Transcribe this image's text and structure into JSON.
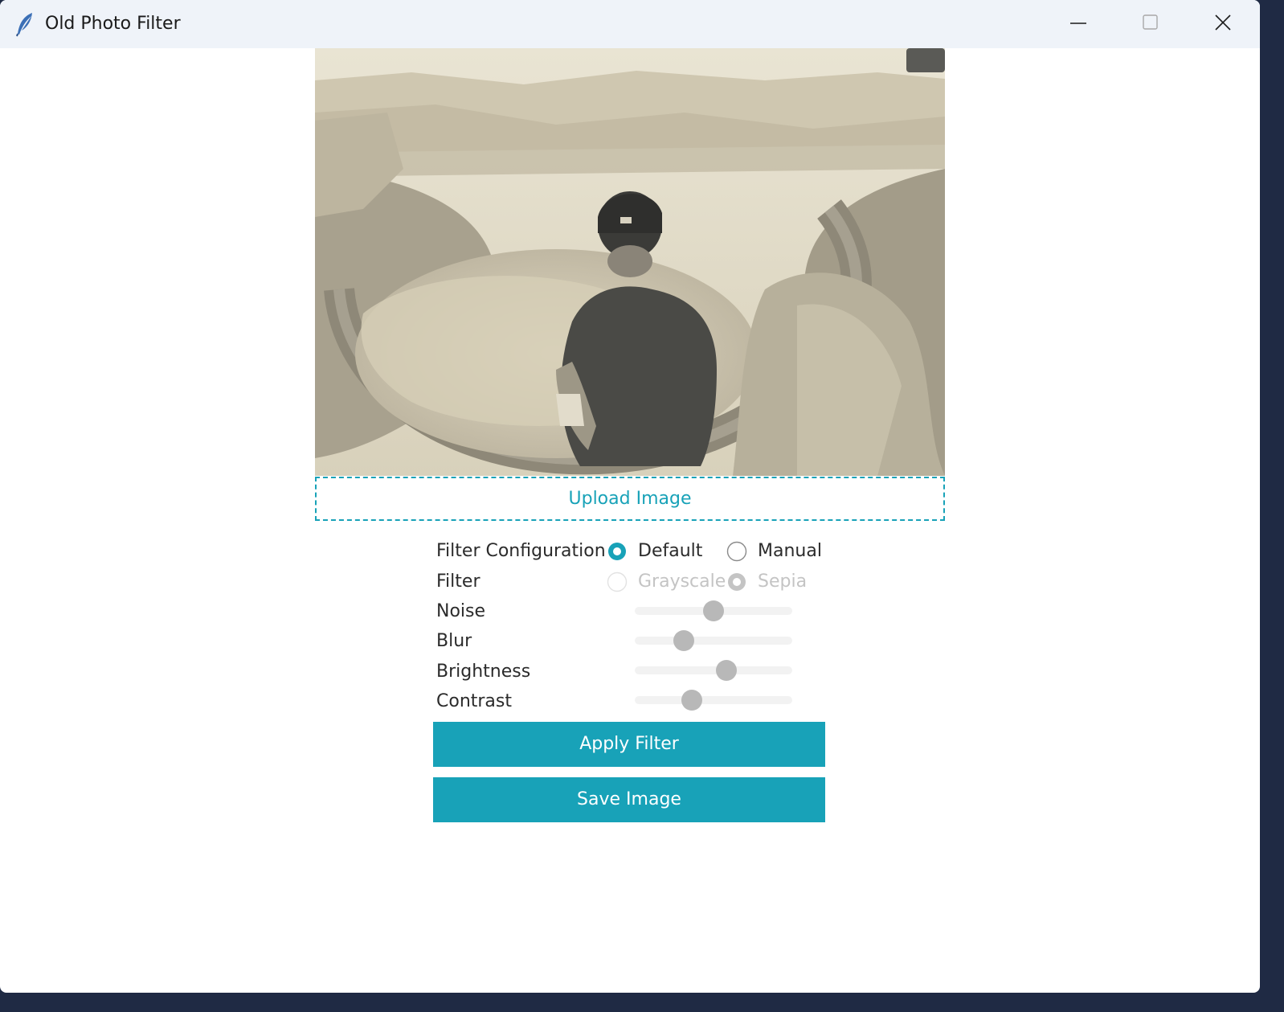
{
  "window": {
    "title": "Old Photo Filter",
    "app_icon": "feather-icon",
    "controls": [
      "minimize-icon",
      "maximize-icon",
      "close-icon"
    ]
  },
  "photo": {
    "description_icon": "image"
  },
  "upload": {
    "label": "Upload Image"
  },
  "form": {
    "filter_configuration": {
      "label": "Filter Configuration",
      "options": [
        {
          "label": "Default",
          "selected": true,
          "enabled": true
        },
        {
          "label": "Manual",
          "selected": false,
          "enabled": true
        }
      ]
    },
    "filter": {
      "label": "Filter",
      "options": [
        {
          "label": "Grayscale",
          "selected": false,
          "enabled": false
        },
        {
          "label": "Sepia",
          "selected": true,
          "enabled": false
        }
      ]
    },
    "sliders": [
      {
        "label": "Noise",
        "value": 0.5,
        "enabled": false
      },
      {
        "label": "Blur",
        "value": 0.31,
        "enabled": false
      },
      {
        "label": "Brightness",
        "value": 0.58,
        "enabled": false
      },
      {
        "label": "Contrast",
        "value": 0.36,
        "enabled": false
      }
    ]
  },
  "buttons": {
    "apply": "Apply Filter",
    "save": "Save Image"
  },
  "colors": {
    "accent": "#18a2b8",
    "titlebar": "#eff3f9",
    "disabled": "#c4c4c4",
    "text": "#2b2b2b"
  }
}
